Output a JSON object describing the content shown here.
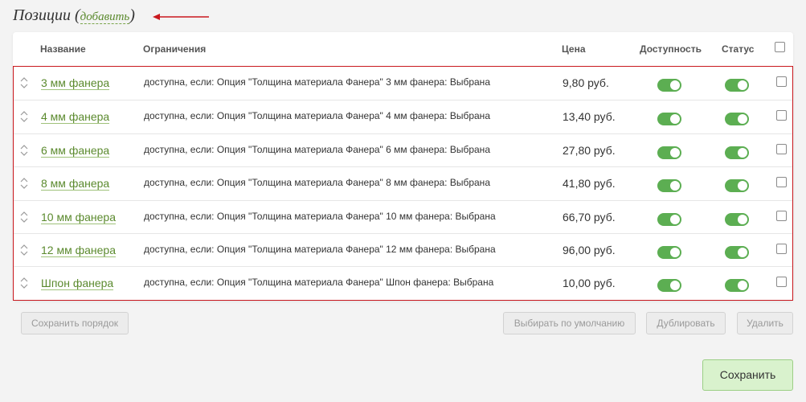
{
  "header": {
    "title": "Позиции",
    "open_paren": "(",
    "add_link": "добавить",
    "close_paren": ")"
  },
  "columns": {
    "name": "Название",
    "constraints": "Ограничения",
    "price": "Цена",
    "availability": "Доступность",
    "status": "Статус"
  },
  "rows": [
    {
      "name": "3 мм фанера",
      "constraint": "доступна, если: Опция \"Толщина материала Фанера\" 3 мм фанера: Выбрана",
      "price": "9,80 руб.",
      "available": true,
      "status": true,
      "checked": false
    },
    {
      "name": "4 мм фанера",
      "constraint": "доступна, если: Опция \"Толщина материала Фанера\" 4 мм фанера: Выбрана",
      "price": "13,40 руб.",
      "available": true,
      "status": true,
      "checked": false
    },
    {
      "name": "6 мм фанера",
      "constraint": "доступна, если: Опция \"Толщина материала Фанера\" 6 мм фанера: Выбрана",
      "price": "27,80 руб.",
      "available": true,
      "status": true,
      "checked": false
    },
    {
      "name": "8 мм фанера",
      "constraint": "доступна, если: Опция \"Толщина материала Фанера\" 8 мм фанера: Выбрана",
      "price": "41,80 руб.",
      "available": true,
      "status": true,
      "checked": false
    },
    {
      "name": "10 мм фанера",
      "constraint": "доступна, если: Опция \"Толщина материала Фанера\" 10 мм фанера: Выбрана",
      "price": "66,70 руб.",
      "available": true,
      "status": true,
      "checked": false
    },
    {
      "name": "12 мм фанера",
      "constraint": "доступна, если: Опция \"Толщина материала Фанера\" 12 мм фанера: Выбрана",
      "price": "96,00 руб.",
      "available": true,
      "status": true,
      "checked": false
    },
    {
      "name": "Шпон фанера",
      "constraint": "доступна, если: Опция \"Толщина материала Фанера\" Шпон фанера: Выбрана",
      "price": "10,00 руб.",
      "available": true,
      "status": true,
      "checked": false
    }
  ],
  "buttons": {
    "save_order": "Сохранить порядок",
    "set_default": "Выбирать по умолчанию",
    "duplicate": "Дублировать",
    "delete": "Удалить",
    "save": "Сохранить"
  },
  "colors": {
    "accent_link": "#5b8a2e",
    "toggle_on": "#5cae52",
    "highlight_border": "#c9181e",
    "save_button_bg": "#d9f2cd"
  },
  "icons": {
    "drag_handle": "drag-handle-icon",
    "arrow": "annotation-arrow-icon"
  }
}
